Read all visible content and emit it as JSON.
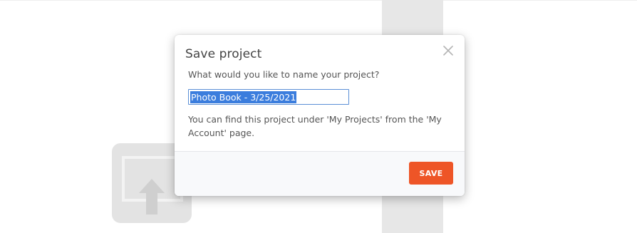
{
  "dialog": {
    "title": "Save project",
    "prompt": "What would you like to name your project?",
    "project_name_value": "Photo Book - 3/25/2021",
    "info": "You can find this project under 'My Projects' from the 'My Account' page.",
    "save_label": "SAVE",
    "close_icon": "close-icon"
  },
  "background": {
    "upload_icon": "upload-arrow-icon"
  },
  "colors": {
    "accent": "#ee5527",
    "selection": "#3b7ddd",
    "input_border": "#5b8fd6"
  }
}
